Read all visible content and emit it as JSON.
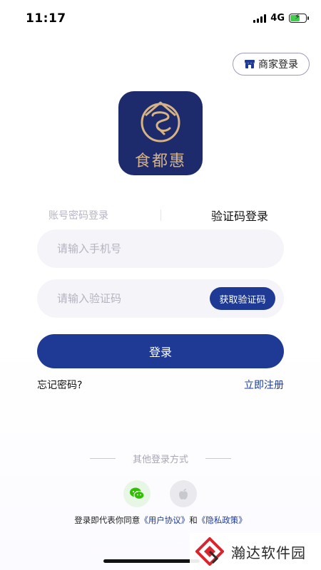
{
  "status_bar": {
    "time": "11:17",
    "network": "4G"
  },
  "merchant_login": {
    "label": "商家登录",
    "icon": "shop-icon"
  },
  "logo": {
    "brand_name": "食都惠",
    "background_color": "#1d2a6b",
    "accent_color": "#d6b384"
  },
  "tabs": {
    "password_login": "账号密码登录",
    "code_login": "验证码登录",
    "active": "code_login"
  },
  "phone_input": {
    "placeholder": "请输入手机号",
    "value": ""
  },
  "code_input": {
    "placeholder": "请输入验证码",
    "value": ""
  },
  "get_code_button": "获取验证码",
  "login_button": "登录",
  "forgot_password": "忘记密码?",
  "register": "立即注册",
  "other_login": {
    "label": "其他登录方式",
    "methods": [
      "wechat-icon",
      "apple-icon"
    ]
  },
  "agreement": {
    "prefix": "登录即代表你同意",
    "user_agreement": "《用户协议》",
    "conjunction": "和",
    "privacy_policy": "《隐私政策》"
  },
  "watermark": {
    "text": "瀚达软件园"
  },
  "colors": {
    "primary": "#1e3a94",
    "input_bg": "#f5f4f9",
    "placeholder": "#b4b3c0"
  }
}
